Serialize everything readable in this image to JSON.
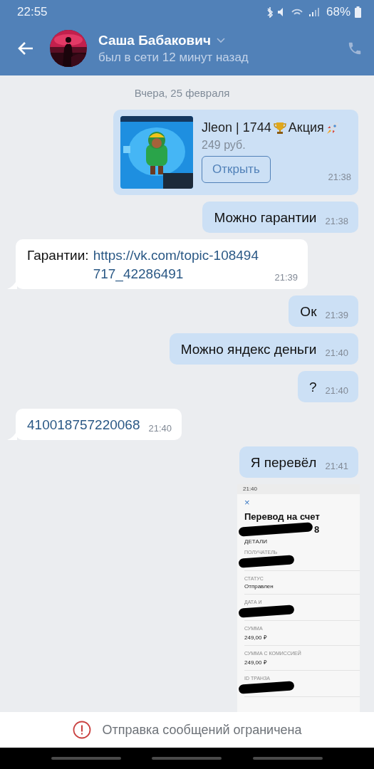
{
  "status_bar": {
    "time": "22:55",
    "battery": "68%"
  },
  "header": {
    "name": "Саша Бабакович",
    "presence": "был в сети 12 минут назад"
  },
  "date_divider": "Вчера, 25 февраля",
  "messages": [
    {
      "kind": "product",
      "outgoing": true,
      "title_parts": [
        "Jleon | 1744",
        "Акция"
      ],
      "price": "249 руб.",
      "button": "Открыть",
      "time": "21:38"
    },
    {
      "kind": "text",
      "outgoing": true,
      "text": "Можно гарантии",
      "time": "21:38"
    },
    {
      "kind": "text",
      "outgoing": false,
      "text": "Гарантии:",
      "link": "https://vk.com/topic‑108494717_42286491",
      "time": "21:39"
    },
    {
      "kind": "text",
      "outgoing": true,
      "text": "Ок",
      "time": "21:39"
    },
    {
      "kind": "text",
      "outgoing": true,
      "text": "Можно яндекс деньги",
      "time": "21:40"
    },
    {
      "kind": "text",
      "outgoing": true,
      "text": "?",
      "time": "21:40"
    },
    {
      "kind": "text",
      "outgoing": false,
      "link": "410018757220068",
      "time": "21:40"
    },
    {
      "kind": "text",
      "outgoing": true,
      "text": "Я перевёл",
      "time": "21:41"
    },
    {
      "kind": "screenshot",
      "outgoing": true,
      "shot": {
        "time": "21:40",
        "close": "×",
        "title": "Перевод на счет",
        "title_tail": "8",
        "section": "ДЕТАЛИ",
        "rows": [
          {
            "label": "ПОЛУЧАТЕЛЬ",
            "redacted": true
          },
          {
            "label": "СТАТУС",
            "value": "Отправлен",
            "redacted": false
          },
          {
            "label": "ДАТА И",
            "redacted": true
          },
          {
            "label": "СУММА",
            "value": "249,00 ₽",
            "redacted": false
          },
          {
            "label": "СУММА С КОМИССИЕЙ",
            "value": "249,00 ₽",
            "redacted": false
          },
          {
            "label": "ID ТРАНЗА",
            "redacted": true
          }
        ]
      }
    }
  ],
  "notice": "Отправка сообщений ограничена"
}
